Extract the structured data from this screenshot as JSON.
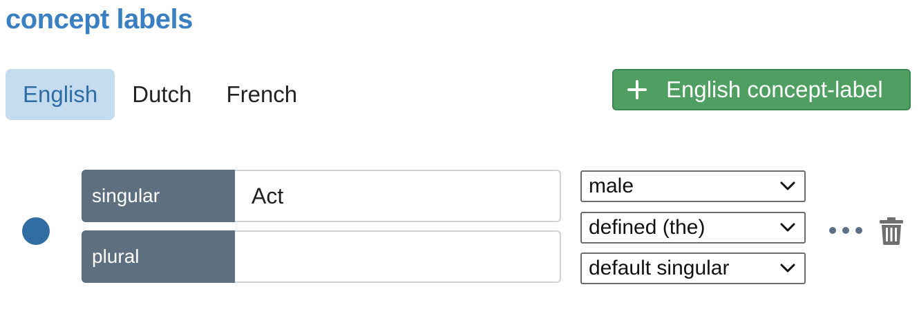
{
  "page_title": "concept labels",
  "tabs": [
    {
      "label": "English",
      "active": true
    },
    {
      "label": "Dutch",
      "active": false
    },
    {
      "label": "French",
      "active": false
    }
  ],
  "add_button": {
    "label": "English concept-label",
    "icon": "plus-icon",
    "color": "#4f9e62"
  },
  "label_entry": {
    "status_color": "#2f6da3",
    "fields": {
      "singular": {
        "label": "singular",
        "value": "Act"
      },
      "plural": {
        "label": "plural",
        "value": ""
      }
    },
    "selects": {
      "gender": {
        "value": "male"
      },
      "article": {
        "value": "defined (the)"
      },
      "number": {
        "value": "default singular"
      }
    },
    "actions": {
      "more_icon": "more-horizontal-icon",
      "delete_icon": "trash-icon"
    }
  },
  "colors": {
    "title": "#3a7fc1",
    "active_tab_bg": "#c5dbee",
    "field_label_bg": "#5e6f80"
  }
}
